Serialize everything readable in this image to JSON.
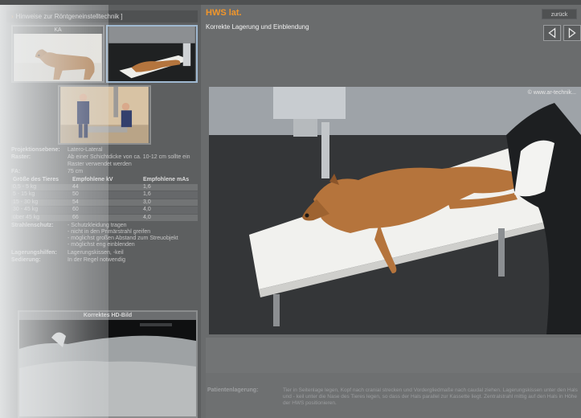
{
  "left": {
    "header_link": "Hinweise zur Röntgeneinstelltechnik ]",
    "thumb1_caption": "KA",
    "info": [
      {
        "k": "Projektionsebene:",
        "v": "Latero-Lateral"
      },
      {
        "k": "Raster:",
        "v": "Ab einer Schichtdicke von ca. 10-12 cm sollte ein Raster verwendet werden"
      },
      {
        "k": "FA:",
        "v": "75 cm"
      }
    ],
    "dose_head": [
      "Größe des Tieres",
      "Empfohlene kV",
      "Empfohlene mAs"
    ],
    "dose_rows": [
      [
        "0,5 - 5 kg",
        "44",
        "1,6"
      ],
      [
        "5 - 15 kg",
        "50",
        "1,6"
      ],
      [
        "15 - 30 kg",
        "54",
        "3,0"
      ],
      [
        "30 - 45 kg",
        "60",
        "4,0"
      ],
      [
        "über 45 kg",
        "66",
        "4,0"
      ]
    ],
    "radiation_label": "Strahlenschutz:",
    "radiation_items": [
      "- Schutzkleidung tragen",
      "- nicht in den Primärstrahl greifen",
      "- möglichst großen Abstand zum Streuobjekt",
      "- möglichst eng einblenden"
    ],
    "aids_label": "Lagerungshilfen:",
    "aids_value": "Lagerungskissen, -keil",
    "sedation_label": "Sedierung:",
    "sedation_value": "In der Regel notwendig",
    "hd_caption": "Korrektes HD-Bild"
  },
  "right": {
    "title": "HWS lat.",
    "subtitle": "Korrekte Lagerung und Einblendung",
    "back_label": "zurück",
    "watermark": "© www.ar-technik...",
    "positioning_label": "Patientenlagerung:",
    "positioning_text": "Tier in Seitenlage legen, Kopf nach cranial strecken und Vordergliedmaße nach caudal ziehen. Lagerungskissen unter den Hals und - keil unter die Nase des Tieres legen, so dass der Hals parallel zur Kassette liegt. Zentralstrahl mittig auf den Hals in Höhe der HWS positionieren."
  },
  "colors": {
    "accent": "#f2962a",
    "panel": "#5d5f60",
    "background": "#6a6c6d"
  },
  "icons": [
    "triangle-left-icon",
    "triangle-right-icon"
  ]
}
